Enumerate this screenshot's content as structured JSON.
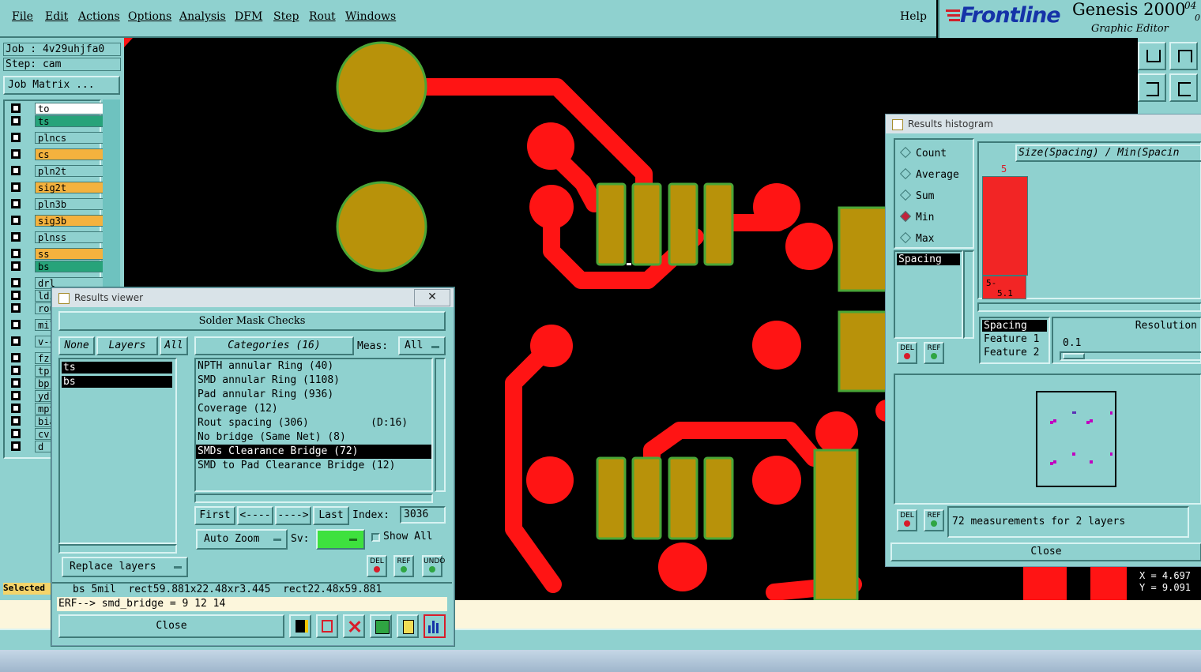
{
  "menu": {
    "items": [
      "File",
      "Edit",
      "Actions",
      "Options",
      "Analysis",
      "DFM",
      "Step",
      "Rout",
      "Windows"
    ],
    "help": "Help"
  },
  "logo": {
    "brand": "Frontline",
    "product": "Genesis 2000",
    "version_top": "04",
    "version_bottom": "0",
    "subtitle": "Graphic Editor"
  },
  "left": {
    "job": "Job : 4v29uhjfa0",
    "step": "Step: cam",
    "job_matrix": "Job Matrix ...",
    "layers": [
      {
        "name": "to",
        "color": "#ffffff"
      },
      {
        "name": "ts",
        "color": "#27a37a"
      },
      {
        "name": "plncs",
        "color": "#8fd1cf"
      },
      {
        "name": "cs",
        "color": "#f4b23e"
      },
      {
        "name": "pln2t",
        "color": "#8fd1cf"
      },
      {
        "name": "sig2t",
        "color": "#f4b23e"
      },
      {
        "name": "pln3b",
        "color": "#8fd1cf"
      },
      {
        "name": "sig3b",
        "color": "#f4b23e"
      },
      {
        "name": "plnss",
        "color": "#8fd1cf"
      },
      {
        "name": "ss",
        "color": "#f4b23e"
      },
      {
        "name": "bs",
        "color": "#27a37a"
      },
      {
        "name": "drl",
        "color": "#8fd1cf"
      },
      {
        "name": "ldi",
        "color": "#8fd1cf"
      },
      {
        "name": "rou",
        "color": "#8fd1cf"
      },
      {
        "name": "mil",
        "color": "#8fd1cf"
      },
      {
        "name": "v-c",
        "color": "#8fd1cf"
      },
      {
        "name": "fzk",
        "color": "#8fd1cf"
      },
      {
        "name": "tp",
        "color": "#8fd1cf"
      },
      {
        "name": "bp",
        "color": "#8fd1cf"
      },
      {
        "name": "ydk",
        "color": "#8fd1cf"
      },
      {
        "name": "mpt",
        "color": "#8fd1cf"
      },
      {
        "name": "bia",
        "color": "#8fd1cf"
      },
      {
        "name": "cvi",
        "color": "#8fd1cf"
      },
      {
        "name": "d",
        "color": "#8fd1cf"
      }
    ],
    "selected": "Selected"
  },
  "results_viewer": {
    "title": "Results viewer",
    "header": "Solder Mask Checks",
    "none": "None",
    "layers": "Layers",
    "all": "All",
    "layer_list": [
      "ts",
      "bs"
    ],
    "categories_label": "Categories (16)",
    "meas_label": "Meas:",
    "meas_value": "All",
    "categories": [
      "NPTH annular Ring (40)",
      "SMD annular Ring (1108)",
      "Pad annular Ring (936)",
      "Coverage (12)",
      "Rout spacing (306)          (D:16)",
      "No bridge (Same Net) (8)",
      "SMDs Clearance Bridge (72)",
      "SMD to Pad Clearance Bridge (12)"
    ],
    "selected_category_index": 6,
    "first": "First",
    "prev": "<----",
    "next": "---->",
    "last": "Last",
    "index_label": "Index:",
    "index_value": "3036",
    "auto_zoom": "Auto Zoom",
    "sv_label": "Sv:",
    "show_all": "Show All",
    "replace_layers": "Replace layers",
    "del": "DEL",
    "ref": "REF",
    "undo": "UNDO",
    "status_line": "bs 5mil  rect59.881x22.48xr3.445  rect22.48x59.881",
    "erf_line": "ERF--> smd_bridge = 9 12 14",
    "close": "Close"
  },
  "histogram": {
    "title": "Results histogram",
    "modes": [
      "Count",
      "Average",
      "Sum",
      "Min",
      "Max"
    ],
    "selected_mode": "Min",
    "list_item": "Spacing",
    "header": "Size(Spacing) / Min(Spacin",
    "bar_value": "5",
    "bin_label_1": "5-",
    "bin_label_2": "5.1",
    "field_options": [
      "Spacing",
      "Feature 1",
      "Feature 2"
    ],
    "resolution_label": "Resolution",
    "resolution_value": "0.1",
    "del": "DEL",
    "ref": "REF",
    "measurements": "72 measurements for 2 layers",
    "close": "Close"
  },
  "coords": {
    "x": "X = 4.697",
    "y": "Y = 9.091"
  },
  "colors": {
    "panel": "#8fd1cf",
    "trace": "#ff1414",
    "pad": "#b8920a",
    "pad_outline": "#4aa637"
  }
}
